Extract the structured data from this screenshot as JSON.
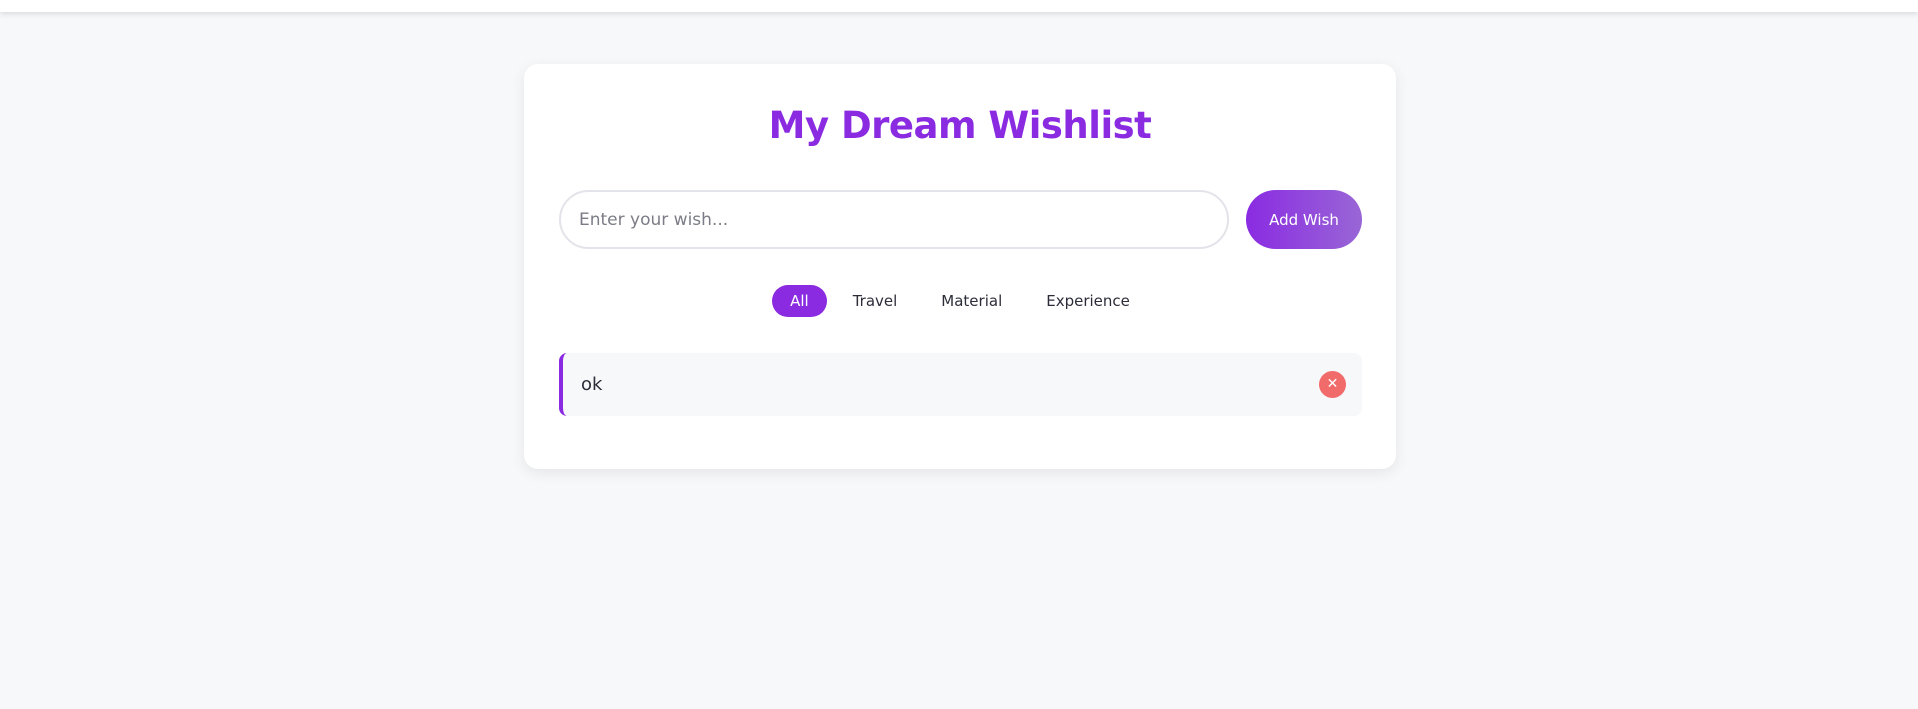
{
  "page": {
    "title": "My Dream Wishlist"
  },
  "form": {
    "input_placeholder": "Enter your wish...",
    "input_value": "",
    "add_label": "Add Wish"
  },
  "filters": [
    {
      "label": "All",
      "active": true
    },
    {
      "label": "Travel",
      "active": false
    },
    {
      "label": "Material",
      "active": false
    },
    {
      "label": "Experience",
      "active": false
    }
  ],
  "wishes": [
    {
      "text": "ok",
      "remove_icon": "✕"
    }
  ],
  "colors": {
    "accent": "#8a2be2",
    "remove": "#f26b6b",
    "background": "#f7f8fa",
    "card": "#ffffff"
  },
  "icons": {
    "remove": "close-icon"
  }
}
